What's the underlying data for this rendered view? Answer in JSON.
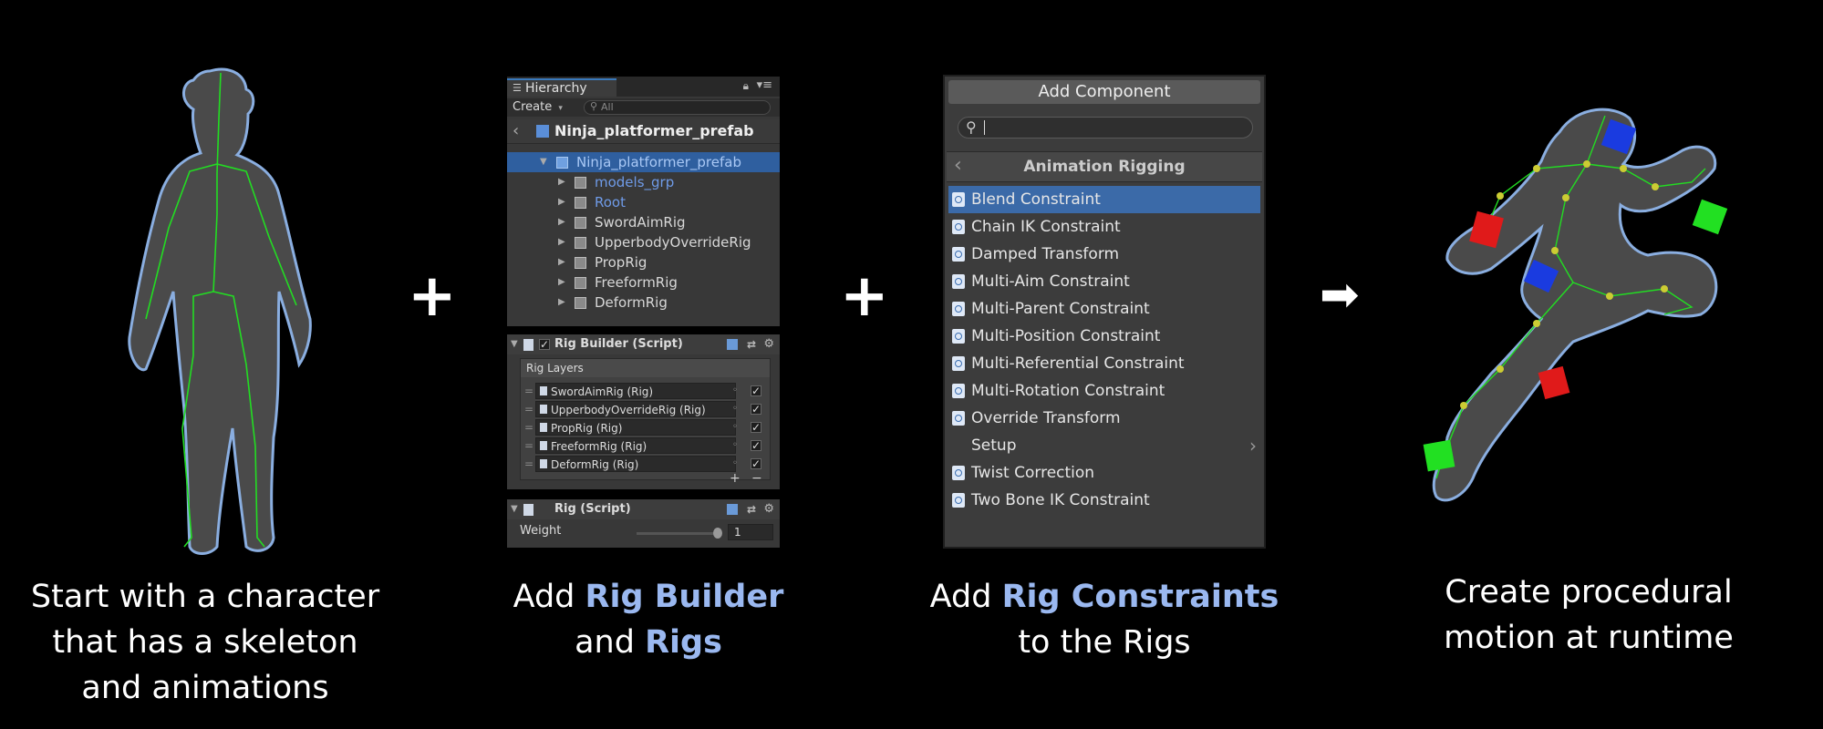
{
  "steps": {
    "plus1": "+",
    "plus2": "+",
    "arrow": "➡"
  },
  "captions": {
    "c1_line1": "Start with a character",
    "c1_line2": "that has a skeleton",
    "c1_line3": "and animations",
    "c2_pre": "Add ",
    "c2_hl1": "Rig Builder",
    "c2_mid": "and ",
    "c2_hl2": "Rigs",
    "c3_pre": "Add ",
    "c3_hl": "Rig Constraints",
    "c3_line2": "to the Rigs",
    "c4_line1": "Create procedural",
    "c4_line2": "motion at runtime"
  },
  "hierarchy": {
    "tab_label": "Hierarchy",
    "create_label": "Create",
    "search_placeholder": "All",
    "header_title": "Ninja_platformer_prefab",
    "items": [
      {
        "label": "Ninja_platformer_prefab"
      },
      {
        "label": "models_grp"
      },
      {
        "label": "Root"
      },
      {
        "label": "SwordAimRig"
      },
      {
        "label": "UpperbodyOverrideRig"
      },
      {
        "label": "PropRig"
      },
      {
        "label": "FreeformRig"
      },
      {
        "label": "DeformRig"
      }
    ]
  },
  "rig_builder": {
    "title": "Rig Builder (Script)",
    "layers_label": "Rig Layers",
    "layers": [
      {
        "label": "SwordAimRig (Rig)"
      },
      {
        "label": "UpperbodyOverrideRig (Rig)"
      },
      {
        "label": "PropRig (Rig)"
      },
      {
        "label": "FreeformRig (Rig)"
      },
      {
        "label": "DeformRig (Rig)"
      }
    ],
    "add_label": "+",
    "remove_label": "−"
  },
  "rig_script": {
    "title": "Rig (Script)",
    "weight_label": "Weight",
    "weight_value": "1"
  },
  "add_component": {
    "button_label": "Add Component",
    "search_value": "",
    "category_label": "Animation Rigging",
    "items": [
      {
        "label": "Blend Constraint"
      },
      {
        "label": "Chain IK Constraint"
      },
      {
        "label": "Damped Transform"
      },
      {
        "label": "Multi-Aim Constraint"
      },
      {
        "label": "Multi-Parent Constraint"
      },
      {
        "label": "Multi-Position Constraint"
      },
      {
        "label": "Multi-Referential Constraint"
      },
      {
        "label": "Multi-Rotation Constraint"
      },
      {
        "label": "Override Transform"
      },
      {
        "label": "Setup"
      },
      {
        "label": "Twist Correction"
      },
      {
        "label": "Two Bone IK Constraint"
      }
    ]
  },
  "colors": {
    "accent": "#9ab8f0",
    "selection": "#3b6aa8",
    "bone": "#22dd22",
    "outline": "#8aaee0"
  }
}
